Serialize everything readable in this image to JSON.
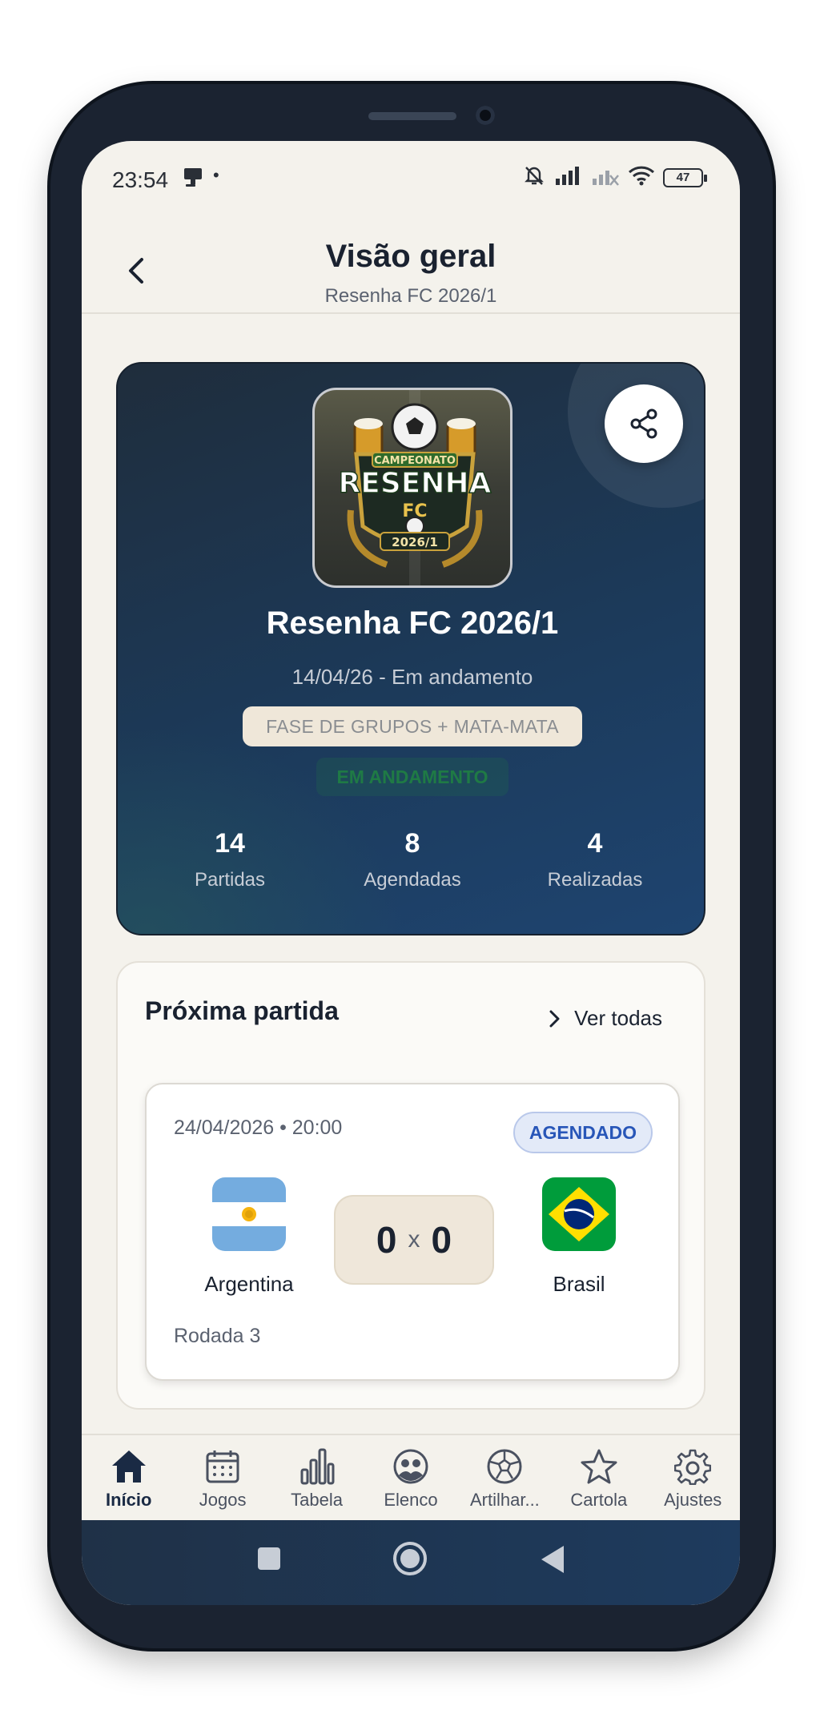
{
  "status_bar": {
    "time": "23:54",
    "dot": "•",
    "battery": "47"
  },
  "header": {
    "title": "Visão geral",
    "subtitle": "Resenha FC 2026/1"
  },
  "hero": {
    "logo": {
      "top_text": "CAMPEONATO",
      "main_text": "RESENHA",
      "sub_text": "FC",
      "year_text": "2026/1"
    },
    "name": "Resenha FC 2026/1",
    "date_status": "14/04/26 - Em andamento",
    "format": "FASE DE GRUPOS + MATA-MATA",
    "status": "EM ANDAMENTO",
    "stats": [
      {
        "value": "14",
        "label": "Partidas"
      },
      {
        "value": "8",
        "label": "Agendadas"
      },
      {
        "value": "4",
        "label": "Realizadas"
      }
    ]
  },
  "next_match": {
    "title": "Próxima partida",
    "see_all": "Ver todas",
    "date_time": "24/04/2026 • 20:00",
    "badge": "AGENDADO",
    "home": {
      "name": "Argentina",
      "score": "0"
    },
    "away": {
      "name": "Brasil",
      "score": "0"
    },
    "separator": "x",
    "round": "Rodada 3"
  },
  "bottom_nav": {
    "items": [
      {
        "label": "Início",
        "icon": "home-icon",
        "active": true
      },
      {
        "label": "Jogos",
        "icon": "calendar-icon"
      },
      {
        "label": "Tabela",
        "icon": "bar-chart-icon"
      },
      {
        "label": "Elenco",
        "icon": "team-icon"
      },
      {
        "label": "Artilhar...",
        "icon": "soccer-ball-icon"
      },
      {
        "label": "Cartola",
        "icon": "star-icon"
      },
      {
        "label": "Ajustes",
        "icon": "gear-icon"
      }
    ]
  },
  "colors": {
    "accent": "#1c3a5a",
    "background": "#f4f2ec",
    "badge": "#2856b8",
    "status_green": "#1f7a45"
  }
}
